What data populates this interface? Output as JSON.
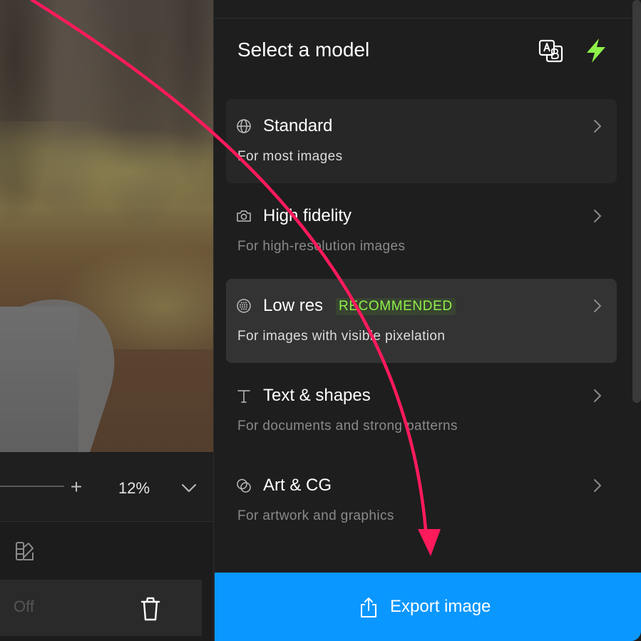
{
  "panel": {
    "title": "Select a model",
    "icons": {
      "translate": "translate-icon",
      "boost": "bolt-icon"
    },
    "accent_color": "#8ef14a"
  },
  "models": [
    {
      "icon": "globe-icon",
      "name": "Standard",
      "description": "For most images",
      "state": "hover"
    },
    {
      "icon": "camera-icon",
      "name": "High fidelity",
      "description": "For high-resolution images",
      "state": "normal"
    },
    {
      "icon": "dotted-circle-icon",
      "name": "Low res",
      "badge": "RECOMMENDED",
      "description": "For images with visible pixelation",
      "state": "selected"
    },
    {
      "icon": "text-icon",
      "name": "Text & shapes",
      "description": "For documents and strong patterns",
      "state": "normal"
    },
    {
      "icon": "art-icon",
      "name": "Art & CG",
      "description": "For artwork and graphics",
      "state": "normal"
    }
  ],
  "zoom": {
    "value": "12%"
  },
  "toggle": {
    "label": "Off"
  },
  "export": {
    "label": "Export image",
    "color": "#0a97ff"
  },
  "annotation": {
    "arrow_color": "#ff1a5c"
  }
}
